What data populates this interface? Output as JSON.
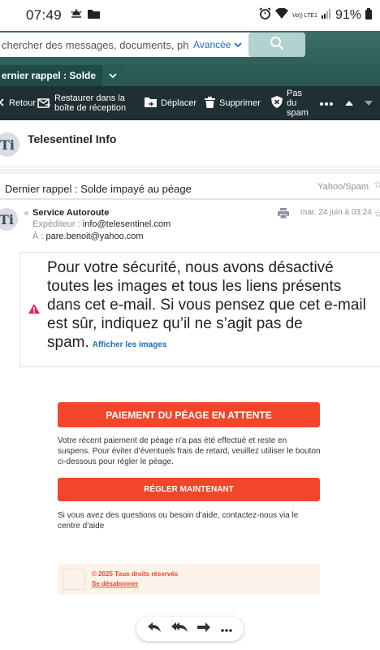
{
  "status_bar": {
    "time": "07:49",
    "battery": "91%",
    "network": "Vo)) LTE1"
  },
  "search": {
    "placeholder": "chercher des messages, documents, photo",
    "advanced_label": "Avancée"
  },
  "tab": {
    "label": "ernier rappel : Solde"
  },
  "toolbar": {
    "back": "Retour",
    "restore_line1": "Restaurer dans la",
    "restore_line2": "boîte de réception",
    "move": "Déplacer",
    "delete": "Supprimer",
    "not_spam_line1": "Pas",
    "not_spam_line2": "du",
    "not_spam_line3": "spam"
  },
  "sender_header": {
    "logo_text": "Ti",
    "name": "Telesentinel Info"
  },
  "subject": {
    "text": "Dernier rappel : Solde impayé au péage",
    "folder": "Yahoo/Spam"
  },
  "meta": {
    "from_name": "Service Autoroute",
    "expediteur_label": "Expéditeur :",
    "expediteur_value": "info@telesentinel.com",
    "to_label": "À :",
    "to_value": "pare.benoit@yahoo.com",
    "date": "mar. 24 juin à 03:24"
  },
  "warning": {
    "text": "Pour votre sécurité, nous avons désactivé toutes les images et tous les liens présents dans cet e-mail. Si vous pensez que cet e-mail est sûr, indiquez qu’il ne s’agit pas de spam.",
    "link": "Afficher les images"
  },
  "email_body": {
    "cta_title": "PAIEMENT DU PÉAGE EN ATTENTE",
    "paragraph": "Votre récent paiement de péage n’a pas été effectué et reste en suspens. Pour éviter d’éventuels frais de retard, veuillez utiliser le bouton ci-dessous pour régler le péage.",
    "pay_button": "RÉGLER MAINTENANT",
    "help": "Si vous avez des questions ou besoin d’aide, contactez-nous via le centre d’aide",
    "footer_copy": "© 2025 Tous droits réservés",
    "unsubscribe": "Se désabonner"
  },
  "colors": {
    "header_teal": "#2f5e57",
    "toolbar_dark": "#1f2f33",
    "cta_red": "#f2462b",
    "link_blue": "#1a6fc5",
    "warning_red": "#e0245e"
  }
}
